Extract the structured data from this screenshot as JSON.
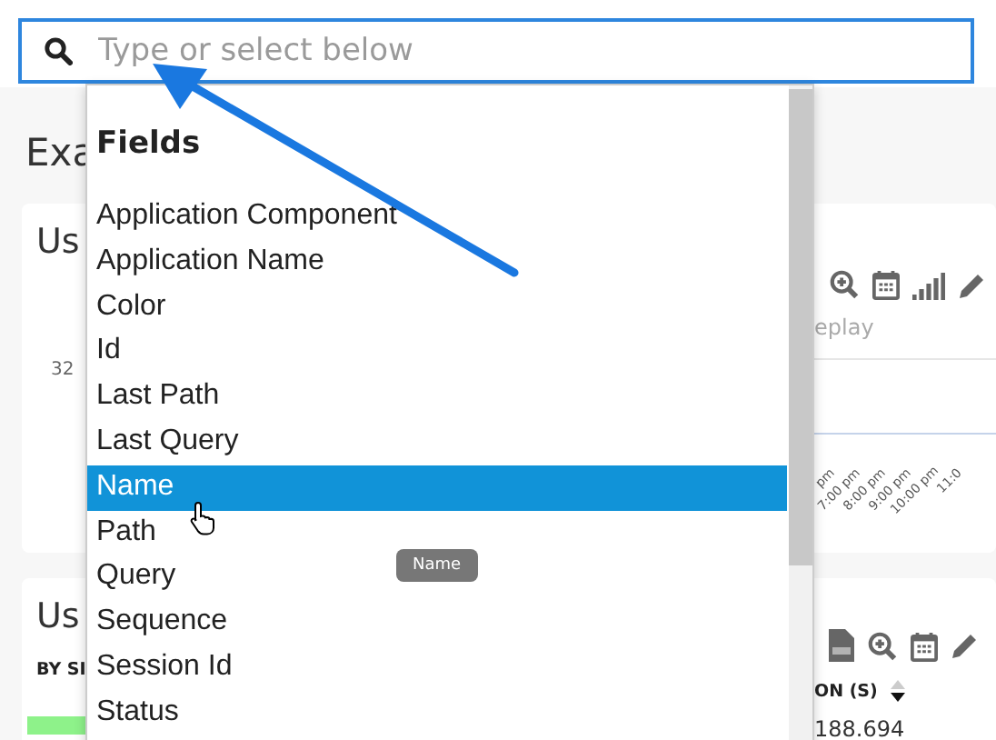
{
  "search": {
    "placeholder": "Type or select below"
  },
  "page_title": "Exa",
  "chart_card": {
    "title": "Us",
    "axis_label": "32",
    "subtitle": "eplay",
    "x_ticks": [
      "pm",
      "7:00 pm",
      "8:00 pm",
      "9:00 pm",
      "10:00 pm",
      "11:0"
    ]
  },
  "table_card": {
    "title": "Us",
    "column_1": "BY SI",
    "column_2": "ON (S)",
    "cell": "188.694"
  },
  "dropdown": {
    "heading": "Fields",
    "items": [
      {
        "label": "Application Component",
        "selected": false
      },
      {
        "label": "Application Name",
        "selected": false
      },
      {
        "label": "Color",
        "selected": false
      },
      {
        "label": "Id",
        "selected": false
      },
      {
        "label": "Last Path",
        "selected": false
      },
      {
        "label": "Last Query",
        "selected": false
      },
      {
        "label": "Name",
        "selected": true
      },
      {
        "label": "Path",
        "selected": false
      },
      {
        "label": "Query",
        "selected": false
      },
      {
        "label": "Sequence",
        "selected": false
      },
      {
        "label": "Session Id",
        "selected": false
      },
      {
        "label": "Status",
        "selected": false
      }
    ],
    "tooltip": "Name"
  }
}
